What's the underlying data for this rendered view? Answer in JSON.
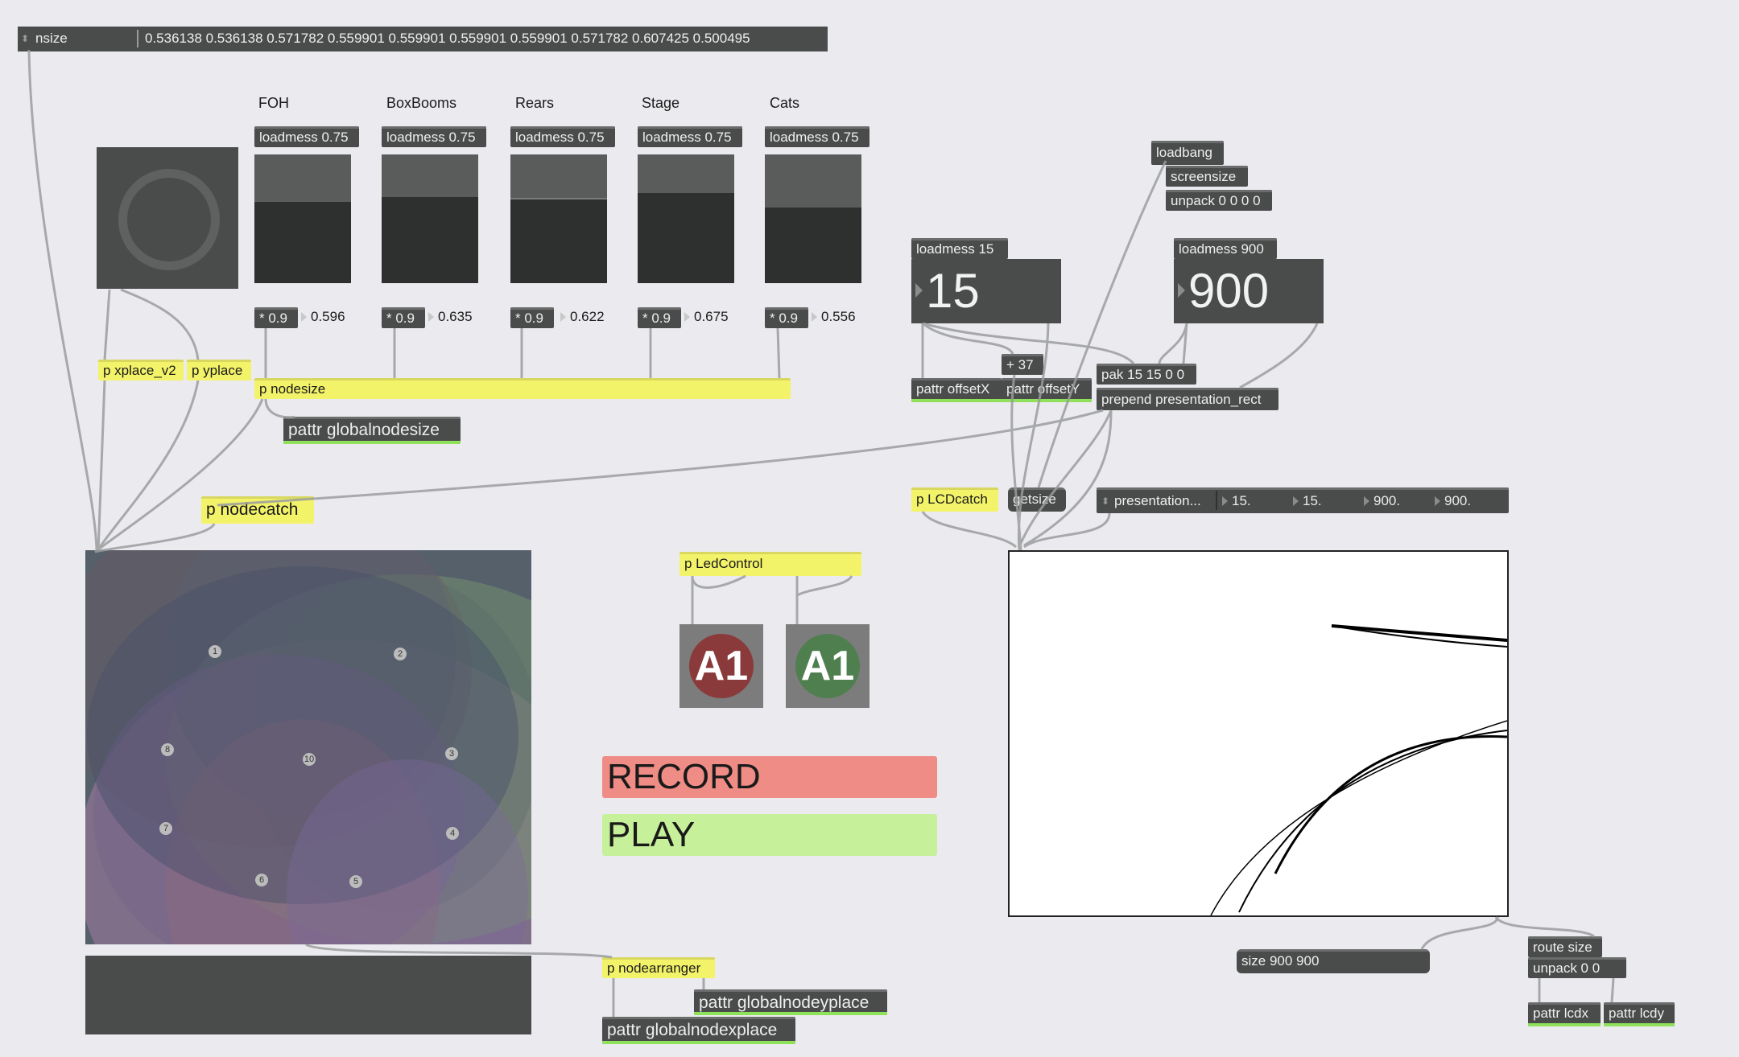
{
  "message_box": {
    "label": "nsize",
    "values": "0.536138 0.536138 0.571782 0.559901 0.559901 0.559901 0.559901 0.571782 0.607425 0.500495"
  },
  "groups": [
    {
      "name": "FOH",
      "loadmess": "loadmess 0.75",
      "mult": "* 0.9",
      "out": "0.596",
      "level": 0.75
    },
    {
      "name": "BoxBooms",
      "loadmess": "loadmess 0.75",
      "mult": "* 0.9",
      "out": "0.635",
      "level": 0.75
    },
    {
      "name": "Rears",
      "loadmess": "loadmess 0.75",
      "mult": "* 0.9",
      "out": "0.622",
      "level": 0.75
    },
    {
      "name": "Stage",
      "loadmess": "loadmess 0.75",
      "mult": "* 0.9",
      "out": "0.675",
      "level": 0.75
    },
    {
      "name": "Cats",
      "loadmess": "loadmess 0.75",
      "mult": "* 0.9",
      "out": "0.556",
      "level": 0.75
    }
  ],
  "objects": {
    "xplace": "p xplace_v2",
    "yplace": "p yplace",
    "nodesize": "p nodesize",
    "globalnodesize": "pattr globalnodesize",
    "nodecatch": "p nodecatch",
    "ledcontrol": "p LedControl",
    "nodearranger": "p nodearranger",
    "globalnodeyplace": "pattr globalnodeyplace",
    "globalnodexplace": "pattr globalnodexplace",
    "loadbang": "loadbang",
    "screensize": "screensize",
    "unpack4": "unpack 0 0 0 0",
    "loadmess15": "loadmess 15",
    "loadmess900": "loadmess 900",
    "plus37": "+ 37",
    "pak": "pak 15 15 0 0",
    "prepend": "prepend presentation_rect",
    "offsetx": "pattr offsetX",
    "offsety": "pattr offsetY",
    "lcdcatch": "p LCDcatch",
    "getsize": "getsize",
    "size_msg": "size 900 900",
    "routesize": "route size",
    "unpack2": "unpack 0 0",
    "lcdx": "pattr lcdx",
    "lcdy": "pattr lcdy"
  },
  "numbers": {
    "offset_x": "15",
    "offset_y": "900"
  },
  "presentation": {
    "label": "presentation...",
    "v1": "15.",
    "v2": "15.",
    "v3": "900.",
    "v4": "900."
  },
  "leds": [
    {
      "label": "A1",
      "color": "#8a3a3a"
    },
    {
      "label": "A1",
      "color": "#4f7f4f"
    }
  ],
  "buttons": {
    "record": "RECORD",
    "record_color": "#ef8c86",
    "play": "PLAY",
    "play_color": "#c6f09a"
  },
  "nodes": [
    "1",
    "2",
    "3",
    "4",
    "5",
    "6",
    "7",
    "8",
    "10"
  ],
  "colors": {
    "background": "#ebebef",
    "object": "#4a4c4c",
    "subpatch": "#f3f36a",
    "pattr_outlet": "#8fe05a"
  }
}
